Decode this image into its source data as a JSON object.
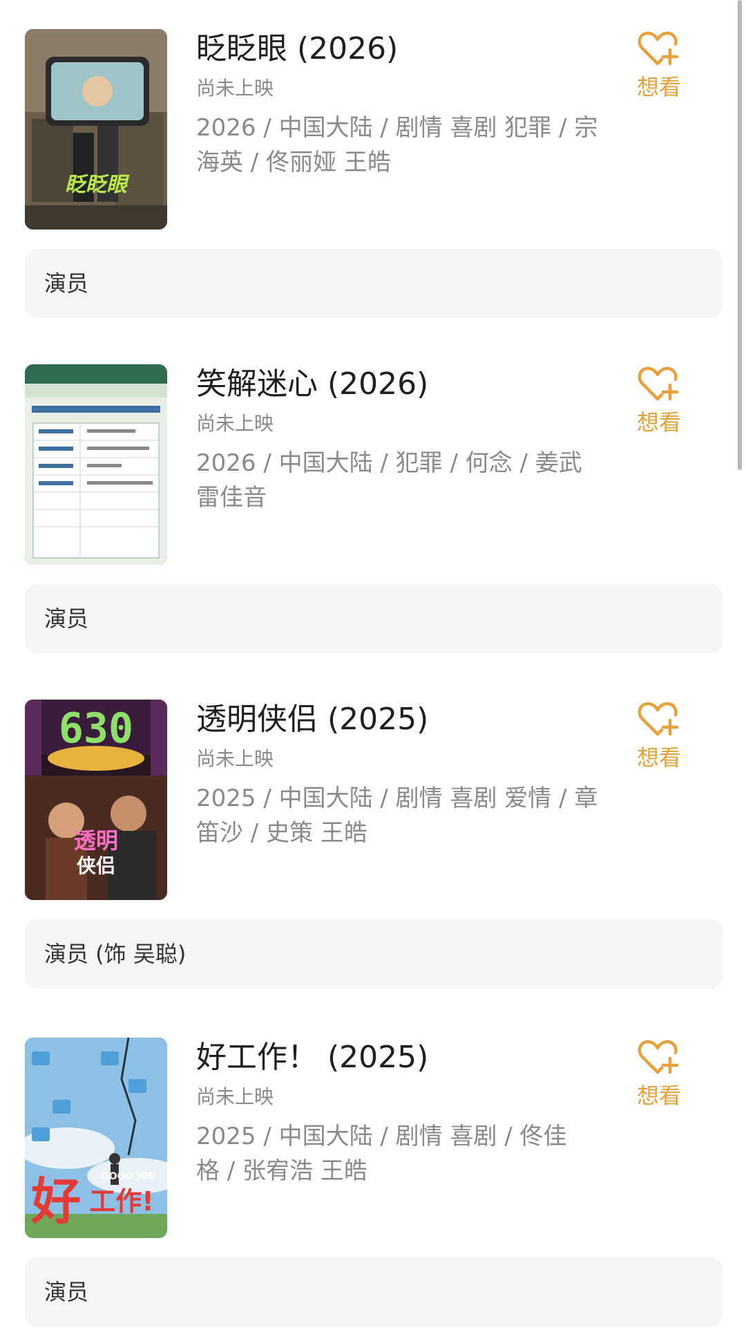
{
  "accent_color": "#e7a13a",
  "movies": [
    {
      "title": "眨眨眼",
      "year": "(2026)",
      "status": "尚未上映",
      "meta_line1": "2026 / 中国大陆 / 剧情 喜剧 犯罪 / 宗",
      "meta_line2": "海英 / 佟丽娅 王皓",
      "wish_label": "想看",
      "role": "演员",
      "poster_icon": "poster-comedy-phone"
    },
    {
      "title": "笑解迷心",
      "year": "(2026)",
      "status": "尚未上映",
      "meta_line1": "2026 / 中国大陆 / 犯罪 / 何念 / 姜武",
      "meta_line2": "雷佳音",
      "wish_label": "想看",
      "role": "演员",
      "poster_icon": "poster-filing-document"
    },
    {
      "title": "透明侠侣",
      "year": "(2025)",
      "status": "尚未上映",
      "meta_line1": "2025 / 中国大陆 / 剧情 喜剧 爱情 / 章",
      "meta_line2": "笛沙 / 史策 王皓",
      "wish_label": "想看",
      "role": "演员 (饰 吴聪)",
      "poster_icon": "poster-taxi-night"
    },
    {
      "title": "好工作！",
      "year": "(2025)",
      "status": "尚未上映",
      "meta_line1": "2025 / 中国大陆 / 剧情 喜剧 / 佟佳",
      "meta_line2": "格 / 张宥浩 王皓",
      "wish_label": "想看",
      "role": "演员",
      "poster_icon": "poster-sky-folders"
    }
  ]
}
